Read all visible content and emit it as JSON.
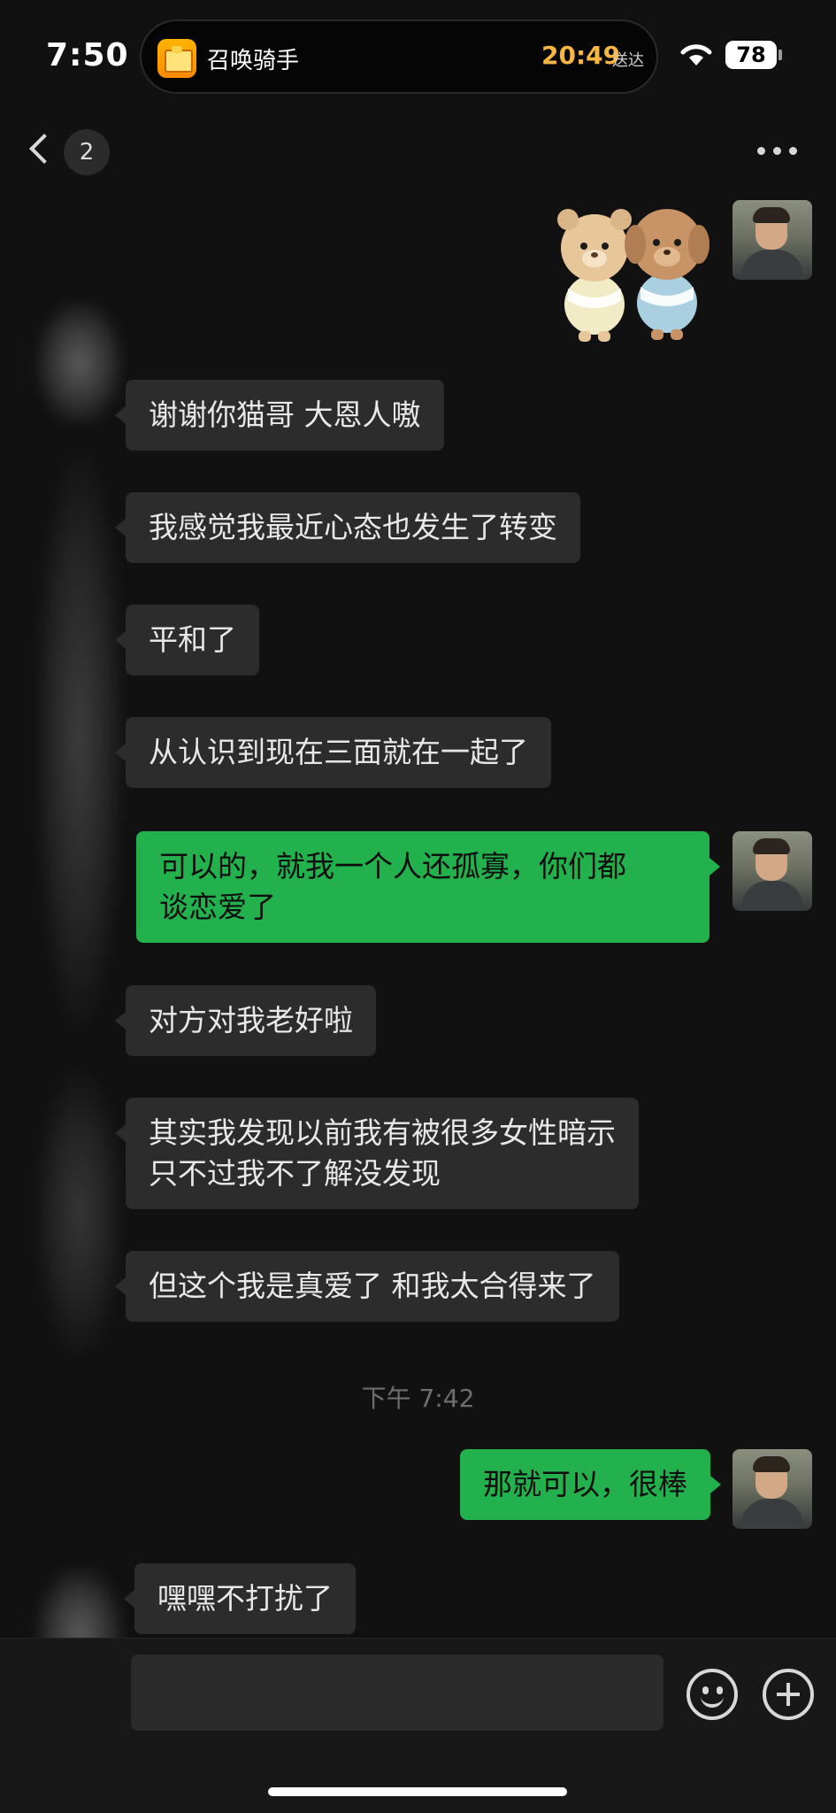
{
  "status_bar": {
    "time": "7:50",
    "live_activity": {
      "app_name": "召唤骑手",
      "eta_time": "20:49",
      "eta_label": "送达"
    },
    "battery": "78"
  },
  "nav": {
    "unread_count": "2"
  },
  "messages": [
    {
      "side": "out",
      "type": "sticker",
      "sticker": "two-plush-bears-sticker"
    },
    {
      "side": "in",
      "text": "谢谢你猫哥 大恩人嗷"
    },
    {
      "side": "in",
      "text": "我感觉我最近心态也发生了转变"
    },
    {
      "side": "in",
      "text": "平和了"
    },
    {
      "side": "in",
      "text": "从认识到现在三面就在一起了"
    },
    {
      "side": "out",
      "text": "可以的，就我一个人还孤寡，你们都\n谈恋爱了"
    },
    {
      "side": "in",
      "text": "对方对我老好啦"
    },
    {
      "side": "in",
      "text": "其实我发现以前我有被很多女性暗示\n只不过我不了解没发现"
    },
    {
      "side": "in",
      "text": "但这个我是真爱了 和我太合得来了"
    },
    {
      "type": "timestamp",
      "text": "下午 7:42"
    },
    {
      "side": "out",
      "text": "那就可以，很棒"
    },
    {
      "side": "in",
      "text": "嘿嘿不打扰了"
    }
  ],
  "icons": {
    "back": "chevron-left-icon",
    "more": "more-dots-icon",
    "emoji": "emoji-icon",
    "plus": "plus-icon",
    "wifi": "wifi-icon"
  },
  "colors": {
    "outgoing_bubble": "#23b14d",
    "incoming_bubble": "#2c2c2c",
    "background": "#111111"
  }
}
